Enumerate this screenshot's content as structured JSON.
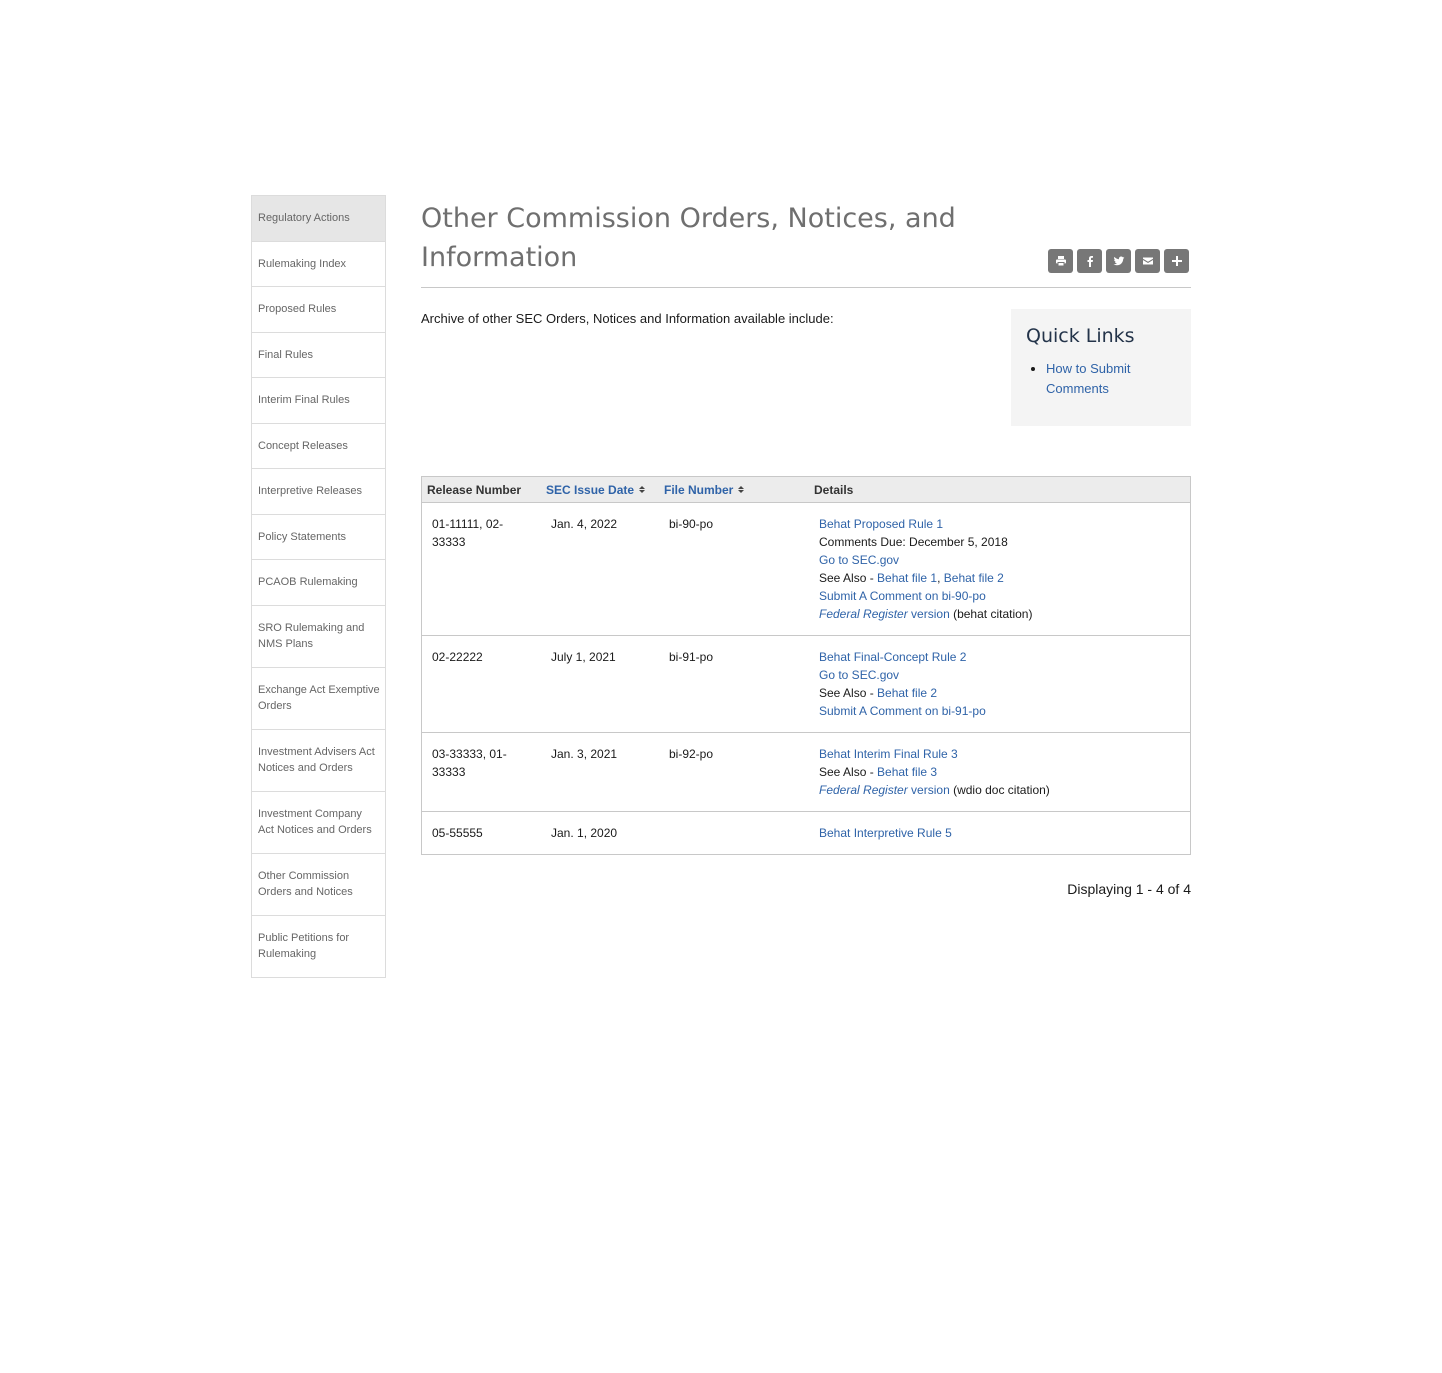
{
  "sidebar": {
    "items": [
      {
        "label": "Regulatory Actions",
        "active": true
      },
      {
        "label": "Rulemaking Index"
      },
      {
        "label": "Proposed Rules"
      },
      {
        "label": "Final Rules"
      },
      {
        "label": "Interim Final Rules"
      },
      {
        "label": "Concept Releases"
      },
      {
        "label": "Interpretive Releases"
      },
      {
        "label": "Policy Statements"
      },
      {
        "label": "PCAOB Rulemaking"
      },
      {
        "label": "SRO Rulemaking and NMS Plans"
      },
      {
        "label": "Exchange Act Exemptive Orders"
      },
      {
        "label": "Investment Advisers Act Notices and Orders"
      },
      {
        "label": "Investment Company Act Notices and Orders"
      },
      {
        "label": "Other Commission Orders and Notices"
      },
      {
        "label": "Public Petitions for Rulemaking"
      }
    ]
  },
  "page": {
    "title": "Other Commission Orders, Notices, and Information",
    "intro": "Archive of other SEC Orders, Notices and Information available include:"
  },
  "share": {
    "icons": [
      "print-icon",
      "facebook-icon",
      "twitter-icon",
      "email-icon",
      "plus-icon"
    ]
  },
  "quick_links": {
    "heading": "Quick Links",
    "items": [
      "How to Submit Comments"
    ]
  },
  "table": {
    "headers": {
      "release_number": "Release Number",
      "sec_issue_date": "SEC Issue Date",
      "file_number": "File Number",
      "details": "Details"
    },
    "rows": [
      {
        "release": "01-11111, 02-33333",
        "date": "Jan. 4, 2022",
        "file": "bi-90-po",
        "title": "Behat Proposed Rule 1",
        "comments_due": "Comments Due: December 5, 2018",
        "go_to": "Go to SEC.gov",
        "see_also_prefix": "See Also - ",
        "see_also_1": "Behat file 1",
        "see_also_sep": ",",
        "see_also_2": "Behat file 2",
        "submit": "Submit A Comment on bi-90-po",
        "fr_italic": "Federal Register",
        "fr_version": " version",
        "fr_citation": " (behat citation)"
      },
      {
        "release": "02-22222",
        "date": "July 1, 2021",
        "file": "bi-91-po",
        "title": "Behat Final-Concept Rule 2",
        "go_to": "Go to SEC.gov",
        "see_also_prefix": "See Also - ",
        "see_also_1": "Behat file 2",
        "submit": "Submit A Comment on bi-91-po"
      },
      {
        "release": "03-33333, 01-33333",
        "date": "Jan. 3, 2021",
        "file": "bi-92-po",
        "title": "Behat Interim Final Rule 3",
        "see_also_prefix": "See Also - ",
        "see_also_1": "Behat file 3",
        "fr_italic": "Federal Register",
        "fr_version": " version",
        "fr_citation": " (wdio doc citation)"
      },
      {
        "release": "05-55555",
        "date": "Jan. 1, 2020",
        "file": "",
        "title": "Behat Interpretive Rule 5"
      }
    ],
    "footer": "Displaying 1 - 4 of 4"
  },
  "colors": {
    "link": "#2f63a8",
    "title": "#6f6f6f",
    "quick_links_heading": "#24344a",
    "share_button": "#777777",
    "sidebar_active": "#e6e6e6"
  }
}
